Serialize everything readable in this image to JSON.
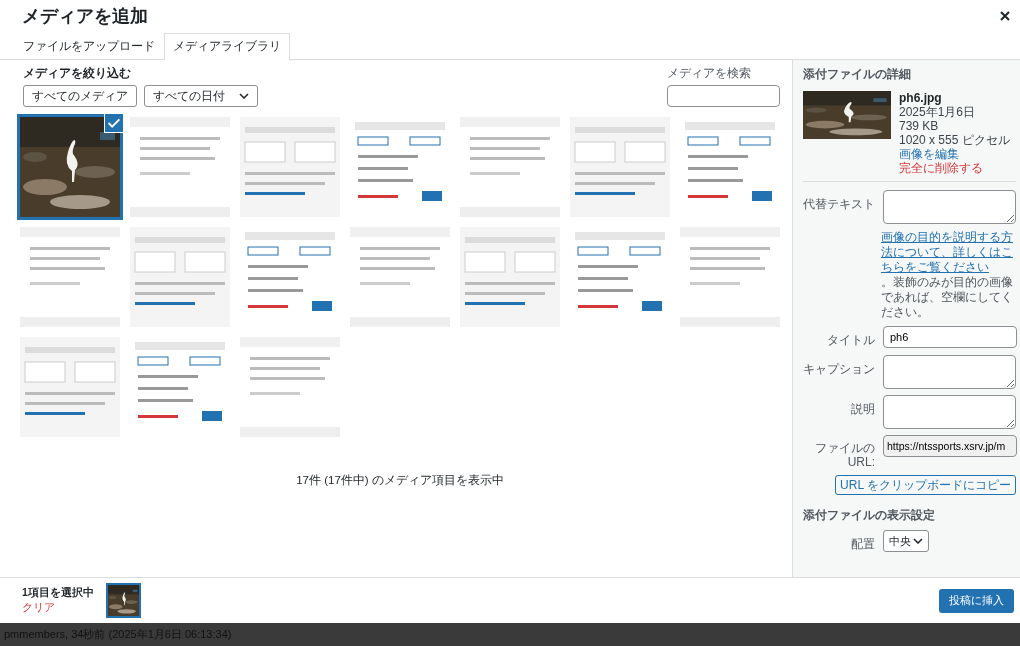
{
  "modal": {
    "title": "メディアを追加"
  },
  "tabs": [
    {
      "label": "ファイルをアップロード",
      "selected": false
    },
    {
      "label": "メディアライブラリ",
      "selected": true
    }
  ],
  "filters": {
    "label": "メディアを絞り込む",
    "type_select": "すべてのメディア",
    "date_select": "すべての日付"
  },
  "search": {
    "label": "メディアを検索"
  },
  "media": {
    "items": [
      {
        "kind": "picture",
        "selected": true
      },
      {
        "kind": "picture",
        "selected": false
      },
      {
        "kind": "picture",
        "selected": false
      },
      {
        "kind": "picture",
        "selected": false
      },
      {
        "kind": "picture",
        "selected": false
      },
      {
        "kind": "picture",
        "selected": false
      },
      {
        "kind": "picture",
        "selected": false
      },
      {
        "kind": "picture",
        "selected": false
      },
      {
        "kind": "picture",
        "selected": false
      },
      {
        "kind": "picture",
        "selected": false
      },
      {
        "kind": "picture",
        "selected": false
      },
      {
        "kind": "picture",
        "selected": false
      },
      {
        "kind": "picture",
        "selected": false
      },
      {
        "kind": "picture",
        "selected": false
      },
      {
        "kind": "picture",
        "selected": false
      },
      {
        "kind": "picture",
        "selected": false
      },
      {
        "kind": "picture",
        "selected": false
      }
    ],
    "count_text": "17件 (17件中) のメディア項目を表示中"
  },
  "details": {
    "heading": "添付ファイルの詳細",
    "filename": "ph6.jpg",
    "date": "2025年1月6日",
    "size": "739 KB",
    "dimensions": "1020 x 555 ピクセル",
    "edit_link": "画像を編集",
    "delete_link": "完全に削除する",
    "alt_label": "代替テキスト",
    "help_link": "画像の目的を説明する方法について、詳しくはこちらをご覧ください",
    "help_text": "。装飾のみが目的の画像であれば、空欄にしてください。",
    "title_label": "タイトル",
    "title_value": "ph6",
    "caption_label": "キャプション",
    "description_label": "説明",
    "url_label": "ファイルの URL:",
    "url_value": "https://ntssports.xsrv.jp/m",
    "copy_button": "URL をクリップボードにコピー"
  },
  "display_settings": {
    "heading": "添付ファイルの表示設定",
    "align_label": "配置",
    "align_value": "中央"
  },
  "footer": {
    "selected_count": "1項目を選択中",
    "clear_link": "クリア",
    "insert_button": "投稿に挿入"
  },
  "background": {
    "revision_text": "pmmembers, 34秒前 (2025年1月6日 06:13:34)"
  }
}
